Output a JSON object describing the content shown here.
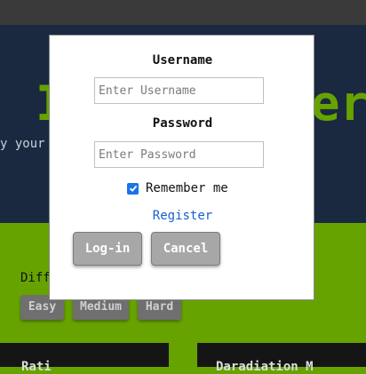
{
  "background": {
    "hero_title_left": "I",
    "hero_title_right": "er",
    "hero_subtitle": "y your",
    "difficulty_label": "Diff",
    "difficulty_buttons": [
      "Easy",
      "Medium",
      "Hard"
    ],
    "bottom_left_text": "Rati",
    "bottom_right_text": "Daradiation M"
  },
  "login_modal": {
    "username_label": "Username",
    "username_placeholder": "Enter Username",
    "username_value": "",
    "password_label": "Password",
    "password_placeholder": "Enter Password",
    "password_value": "",
    "remember_label": "Remember me",
    "remember_checked": true,
    "register_link": "Register",
    "login_button": "Log-in",
    "cancel_button": "Cancel"
  },
  "colors": {
    "accent_green": "#67a300",
    "hero_navy": "#1a2940",
    "link_blue": "#1a5fd0",
    "checkbox_blue": "#1a73e8"
  }
}
